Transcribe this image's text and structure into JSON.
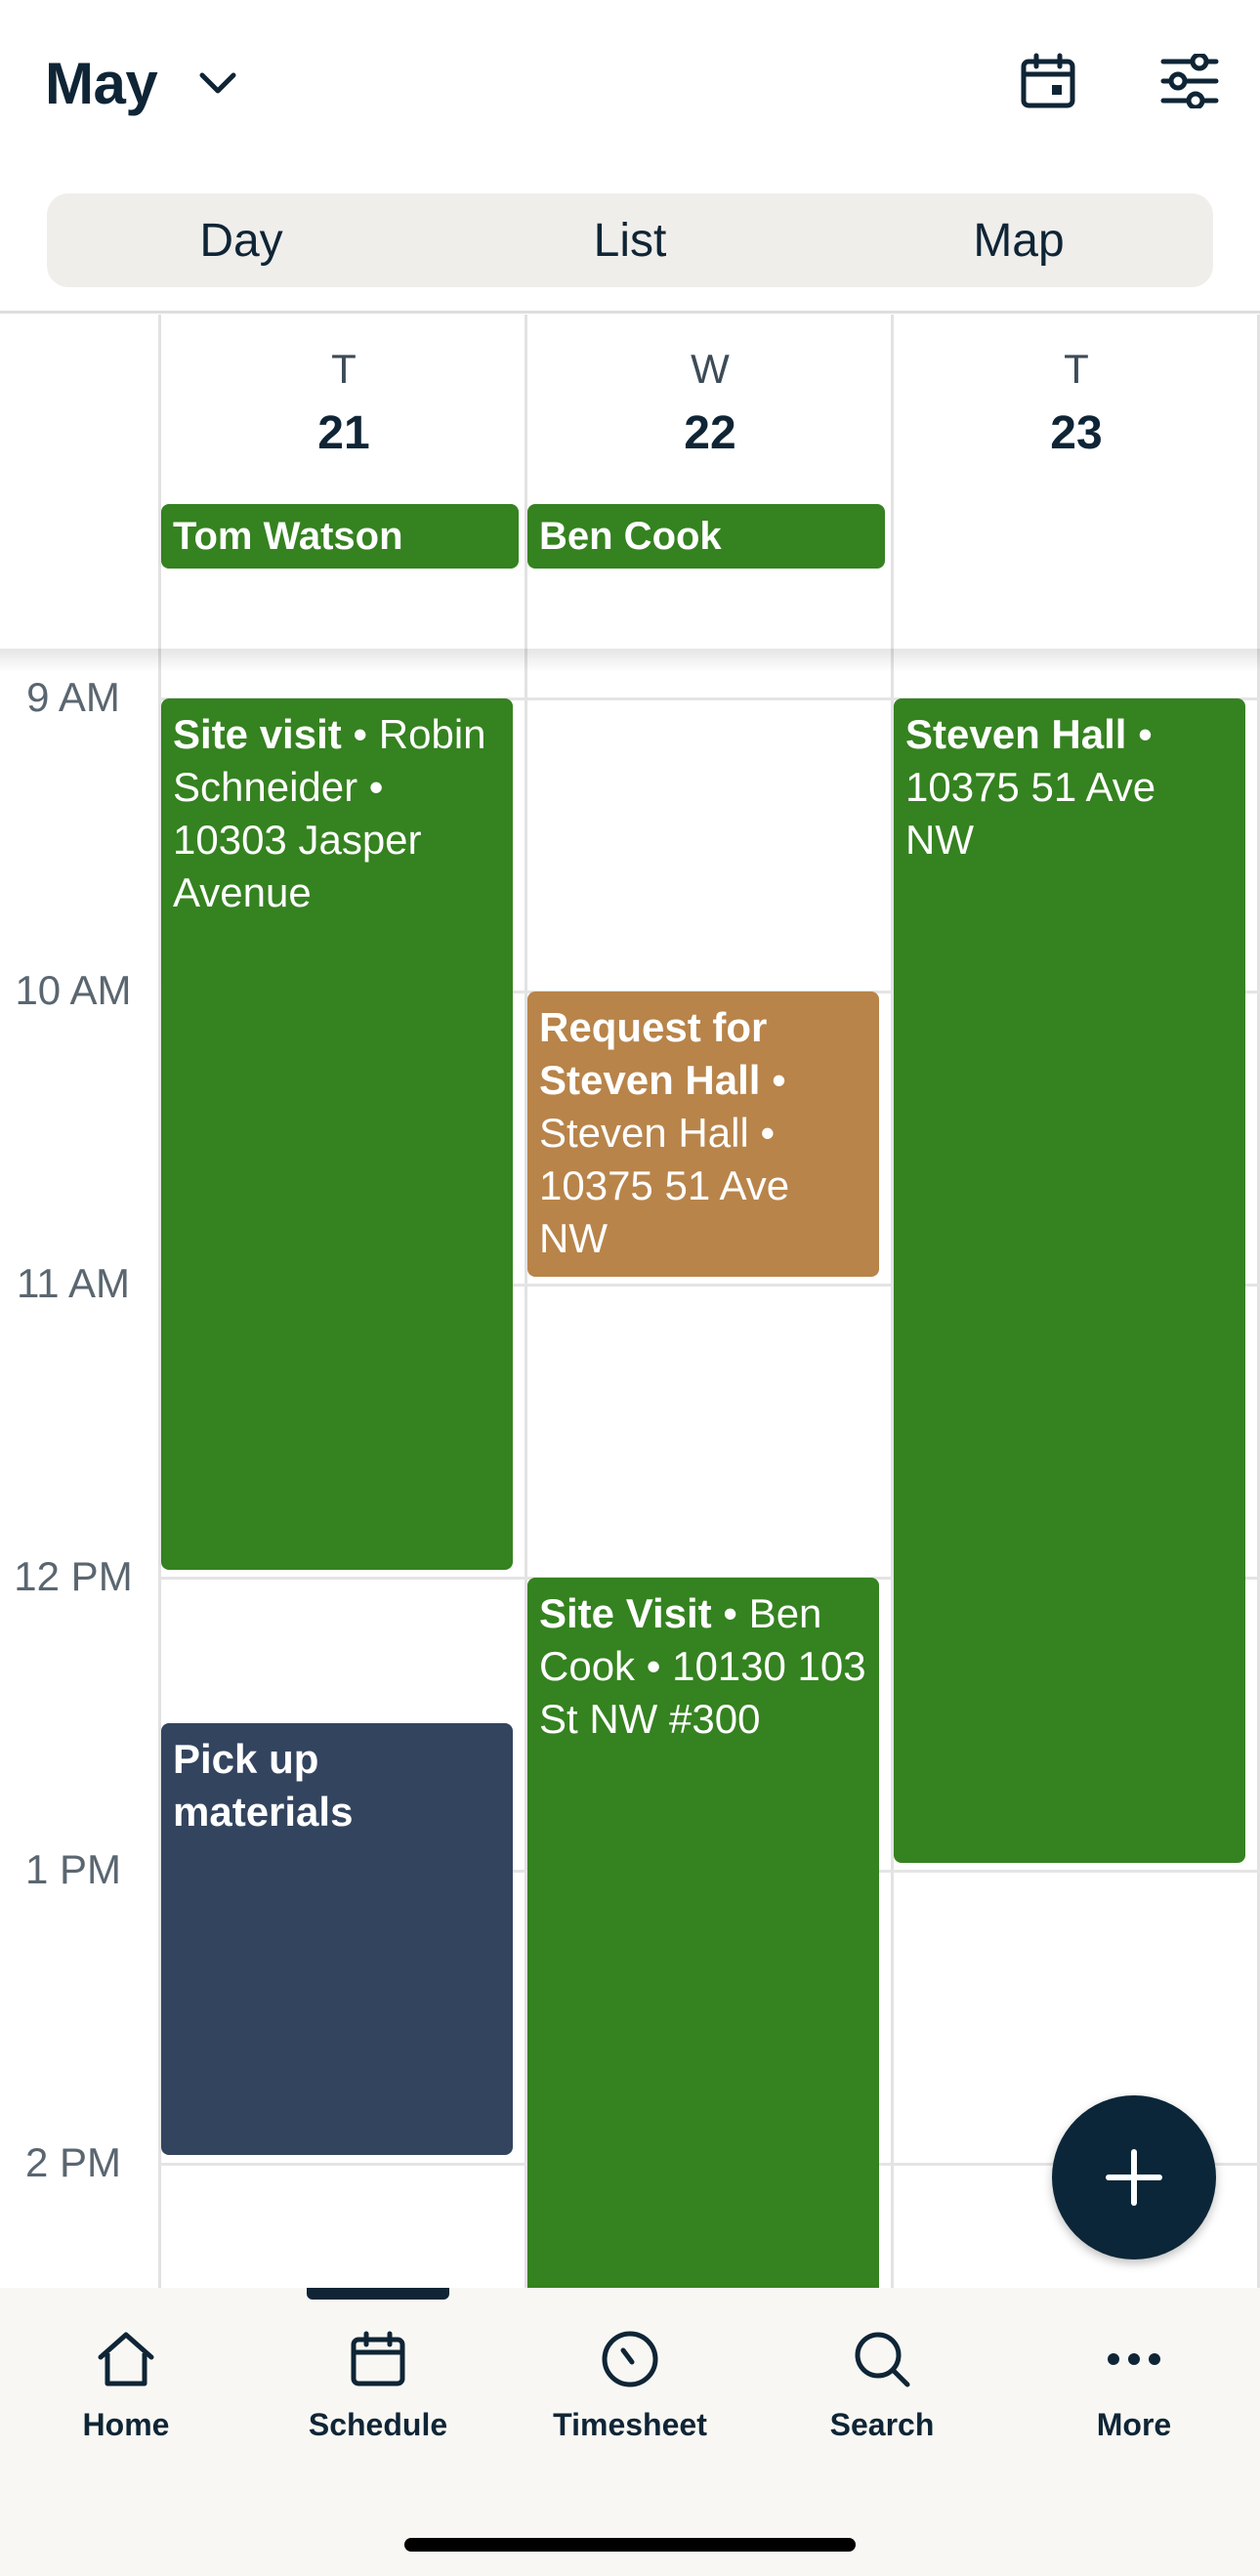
{
  "header": {
    "month": "May",
    "chevron_icon": "chevron-down-icon",
    "calendar_icon": "calendar-icon",
    "filter_icon": "sliders-icon"
  },
  "view_tabs": [
    "Day",
    "List",
    "Map"
  ],
  "days": [
    {
      "letter": "T",
      "date": "21",
      "assignee": "Tom Watson"
    },
    {
      "letter": "W",
      "date": "22",
      "assignee": "Ben Cook"
    },
    {
      "letter": "T",
      "date": "23",
      "assignee": ""
    }
  ],
  "time_labels": [
    "9 AM",
    "10 AM",
    "11 AM",
    "12 PM",
    "1 PM",
    "2 PM"
  ],
  "events": [
    {
      "title": "Site visit",
      "details": " • Robin Schneider • 10303 Jasper Avenue",
      "color": "#358220"
    },
    {
      "title": "Pick up materials",
      "details": "",
      "color": "#33445f"
    },
    {
      "title": "Request for Steven Hall",
      "details": " • Steven Hall • 10375 51 Ave NW",
      "color": "#b8844a"
    },
    {
      "title": "Site Visit",
      "details": " • Ben Cook • 10130 103 St NW #300",
      "color": "#358220"
    },
    {
      "title": "Steven Hall",
      "details": " • 10375 51 Ave NW",
      "color": "#358220"
    }
  ],
  "fab_icon": "plus-icon",
  "nav": [
    {
      "label": "Home",
      "icon": "home-icon"
    },
    {
      "label": "Schedule",
      "icon": "calendar-icon"
    },
    {
      "label": "Timesheet",
      "icon": "clock-icon"
    },
    {
      "label": "Search",
      "icon": "search-icon"
    },
    {
      "label": "More",
      "icon": "more-icon"
    }
  ],
  "active_nav": "Schedule"
}
